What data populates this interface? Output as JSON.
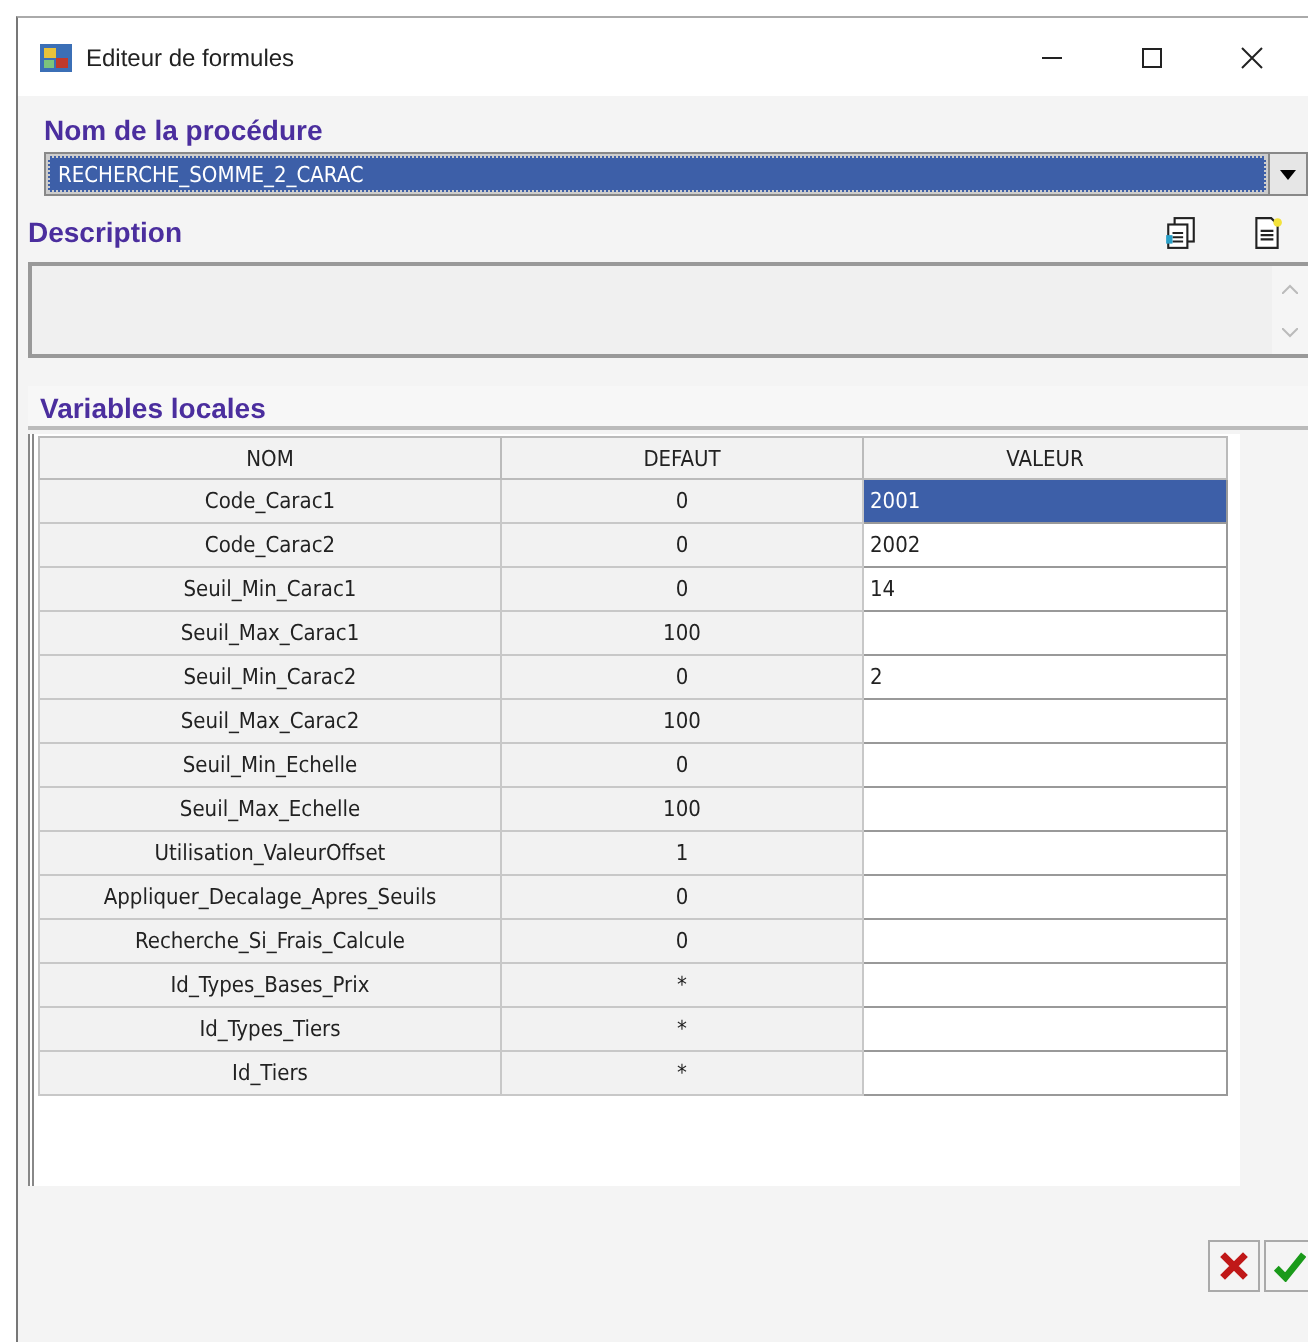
{
  "window": {
    "title": "Editeur de formules"
  },
  "procedure": {
    "label": "Nom de la procédure",
    "value": "RECHERCHE_SOMME_2_CARAC"
  },
  "description": {
    "label": "Description"
  },
  "variables": {
    "label": "Variables locales",
    "columns": [
      "NOM",
      "DEFAUT",
      "VALEUR"
    ],
    "rows": [
      {
        "nom": "Code_Carac1",
        "defaut": "0",
        "valeur": "2001",
        "selected": true
      },
      {
        "nom": "Code_Carac2",
        "defaut": "0",
        "valeur": "2002",
        "selected": false
      },
      {
        "nom": "Seuil_Min_Carac1",
        "defaut": "0",
        "valeur": "14",
        "selected": false
      },
      {
        "nom": "Seuil_Max_Carac1",
        "defaut": "100",
        "selected": false
      },
      {
        "nom": "Seuil_Min_Carac2",
        "defaut": "0",
        "valeur": "2",
        "selected": false
      },
      {
        "nom": "Seuil_Max_Carac2",
        "defaut": "100",
        "selected": false
      },
      {
        "nom": "Seuil_Min_Echelle",
        "defaut": "0",
        "selected": false
      },
      {
        "nom": "Seuil_Max_Echelle",
        "defaut": "100",
        "selected": false
      },
      {
        "nom": "Utilisation_ValeurOffset",
        "defaut": "1",
        "selected": false
      },
      {
        "nom": "Appliquer_Decalage_Apres_Seuils",
        "defaut": "0",
        "selected": false
      },
      {
        "nom": "Recherche_Si_Frais_Calcule",
        "defaut": "0",
        "selected": false
      },
      {
        "nom": "Id_Types_Bases_Prix",
        "defaut": "*",
        "selected": false
      },
      {
        "nom": "Id_Types_Tiers",
        "defaut": "*",
        "selected": false
      },
      {
        "nom": "Id_Tiers",
        "defaut": "*",
        "selected": false
      }
    ]
  }
}
